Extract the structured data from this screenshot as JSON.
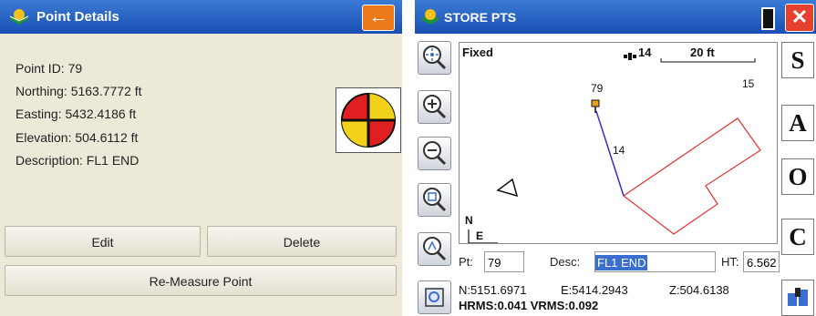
{
  "left": {
    "title": "Point Details",
    "back_icon": "←",
    "point_id": "Point ID: 79",
    "northing": "Northing: 5163.7772 ft",
    "easting": "Easting: 5432.4186 ft",
    "elevation": "Elevation: 504.6112 ft",
    "description": "Description: FL1 END",
    "edit_label": "Edit",
    "delete_label": "Delete",
    "remeasure_label": "Re-Measure Point"
  },
  "right": {
    "title": "STORE PTS",
    "close_label": "✕",
    "status": "Fixed",
    "sat_count": "14",
    "scale": "20 ft",
    "map_labels": {
      "pt79": "79",
      "pt15": "15",
      "pt14": "14",
      "north": "N",
      "east": "E"
    },
    "pt_label": "Pt:",
    "pt_value": "79",
    "desc_label": "Desc:",
    "desc_value": "FL1 END",
    "ht_label": "HT:",
    "ht_value": "6.562",
    "n_value": "N:5151.6971",
    "e_value": "E:5414.2943",
    "z_value": "Z:504.6138",
    "hrms": "HRMS:0.041 VRMS:0.092",
    "side_buttons": [
      "S",
      "A",
      "O",
      "C"
    ]
  },
  "colors": {
    "titlebar": "#1a4fb3",
    "accent_orange": "#ec7a1a",
    "close_red": "#e8402f",
    "polygon_red": "#e83030",
    "line_blue": "#3030d0"
  }
}
